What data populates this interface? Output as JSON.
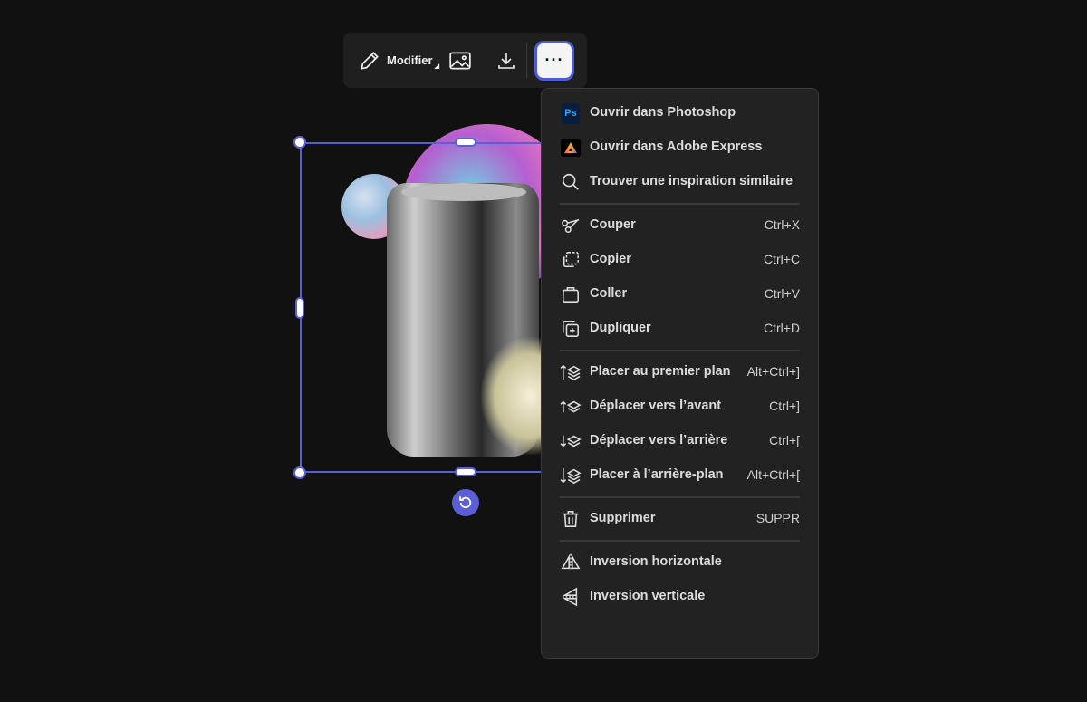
{
  "toolbar": {
    "edit_label": "Modifier"
  },
  "menu": {
    "group1": [
      {
        "label": "Ouvrir dans Photoshop",
        "icon": "photoshop-icon",
        "badge": "Ps"
      },
      {
        "label": "Ouvrir dans Adobe Express",
        "icon": "adobe-express-icon"
      },
      {
        "label": "Trouver une inspiration similaire",
        "icon": "search-icon"
      }
    ],
    "group2": [
      {
        "label": "Couper",
        "shortcut": "Ctrl+X"
      },
      {
        "label": "Copier",
        "shortcut": "Ctrl+C"
      },
      {
        "label": "Coller",
        "shortcut": "Ctrl+V"
      },
      {
        "label": "Dupliquer",
        "shortcut": "Ctrl+D"
      }
    ],
    "group3": [
      {
        "label": "Placer au premier plan",
        "shortcut": "Alt+Ctrl+]"
      },
      {
        "label": "Déplacer vers l’avant",
        "shortcut": "Ctrl+]"
      },
      {
        "label": "Déplacer vers l’arrière",
        "shortcut": "Ctrl+["
      },
      {
        "label": "Placer à l’arrière-plan",
        "shortcut": "Alt+Ctrl+["
      }
    ],
    "group4": [
      {
        "label": "Supprimer",
        "shortcut": "SUPPR"
      }
    ],
    "group5": [
      {
        "label": "Inversion horizontale"
      },
      {
        "label": "Inversion verticale"
      }
    ]
  }
}
